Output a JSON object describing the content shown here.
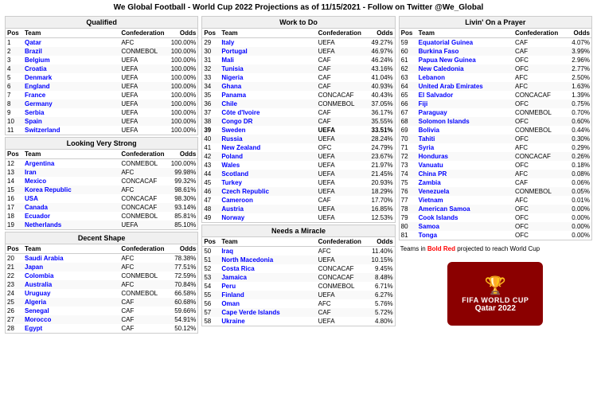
{
  "header": {
    "title": "We Global Football - World Cup 2022 Projections as of 11/15/2021 - Follow on Twitter @We_Global"
  },
  "sections": {
    "qualified": {
      "title": "Qualified",
      "columns": [
        "Pos",
        "Team",
        "Confederation",
        "Odds"
      ],
      "rows": [
        {
          "pos": "1",
          "team": "Qatar",
          "conf": "AFC",
          "odds": "100.00%"
        },
        {
          "pos": "2",
          "team": "Brazil",
          "conf": "CONMEBOL",
          "odds": "100.00%"
        },
        {
          "pos": "3",
          "team": "Belgium",
          "conf": "UEFA",
          "odds": "100.00%"
        },
        {
          "pos": "4",
          "team": "Croatia",
          "conf": "UEFA",
          "odds": "100.00%"
        },
        {
          "pos": "5",
          "team": "Denmark",
          "conf": "UEFA",
          "odds": "100.00%"
        },
        {
          "pos": "6",
          "team": "England",
          "conf": "UEFA",
          "odds": "100.00%"
        },
        {
          "pos": "7",
          "team": "France",
          "conf": "UEFA",
          "odds": "100.00%"
        },
        {
          "pos": "8",
          "team": "Germany",
          "conf": "UEFA",
          "odds": "100.00%"
        },
        {
          "pos": "9",
          "team": "Serbia",
          "conf": "UEFA",
          "odds": "100.00%"
        },
        {
          "pos": "10",
          "team": "Spain",
          "conf": "UEFA",
          "odds": "100.00%"
        },
        {
          "pos": "11",
          "team": "Switzerland",
          "conf": "UEFA",
          "odds": "100.00%"
        }
      ]
    },
    "looking_strong": {
      "title": "Looking Very Strong",
      "columns": [
        "Pos",
        "Team",
        "Confederation",
        "Odds"
      ],
      "rows": [
        {
          "pos": "12",
          "team": "Argentina",
          "conf": "CONMEBOL",
          "odds": "100.00%"
        },
        {
          "pos": "13",
          "team": "Iran",
          "conf": "AFC",
          "odds": "99.98%"
        },
        {
          "pos": "14",
          "team": "Mexico",
          "conf": "CONCACAF",
          "odds": "99.32%"
        },
        {
          "pos": "15",
          "team": "Korea Republic",
          "conf": "AFC",
          "odds": "98.61%"
        },
        {
          "pos": "16",
          "team": "USA",
          "conf": "CONCACAF",
          "odds": "98.30%"
        },
        {
          "pos": "17",
          "team": "Canada",
          "conf": "CONCACAF",
          "odds": "93.14%"
        },
        {
          "pos": "18",
          "team": "Ecuador",
          "conf": "CONMEBOL",
          "odds": "85.81%"
        },
        {
          "pos": "19",
          "team": "Netherlands",
          "conf": "UEFA",
          "odds": "85.10%"
        }
      ]
    },
    "decent": {
      "title": "Decent Shape",
      "columns": [
        "Pos",
        "Team",
        "Confederation",
        "Odds"
      ],
      "rows": [
        {
          "pos": "20",
          "team": "Saudi Arabia",
          "conf": "AFC",
          "odds": "78.38%"
        },
        {
          "pos": "21",
          "team": "Japan",
          "conf": "AFC",
          "odds": "77.51%"
        },
        {
          "pos": "22",
          "team": "Colombia",
          "conf": "CONMEBOL",
          "odds": "72.59%"
        },
        {
          "pos": "23",
          "team": "Australia",
          "conf": "AFC",
          "odds": "70.84%"
        },
        {
          "pos": "24",
          "team": "Uruguay",
          "conf": "CONMEBOL",
          "odds": "66.58%"
        },
        {
          "pos": "25",
          "team": "Algeria",
          "conf": "CAF",
          "odds": "60.68%"
        },
        {
          "pos": "26",
          "team": "Senegal",
          "conf": "CAF",
          "odds": "59.66%"
        },
        {
          "pos": "27",
          "team": "Morocco",
          "conf": "CAF",
          "odds": "54.91%"
        },
        {
          "pos": "28",
          "team": "Egypt",
          "conf": "CAF",
          "odds": "50.12%"
        }
      ]
    },
    "work_todo": {
      "title": "Work to Do",
      "columns": [
        "Pos",
        "Team",
        "Confederation",
        "Odds"
      ],
      "rows": [
        {
          "pos": "29",
          "team": "Italy",
          "conf": "UEFA",
          "odds": "49.27%"
        },
        {
          "pos": "30",
          "team": "Portugal",
          "conf": "UEFA",
          "odds": "46.97%"
        },
        {
          "pos": "31",
          "team": "Mali",
          "conf": "CAF",
          "odds": "46.24%"
        },
        {
          "pos": "32",
          "team": "Tunisia",
          "conf": "CAF",
          "odds": "43.16%"
        },
        {
          "pos": "33",
          "team": "Nigeria",
          "conf": "CAF",
          "odds": "41.04%"
        },
        {
          "pos": "34",
          "team": "Ghana",
          "conf": "CAF",
          "odds": "40.93%"
        },
        {
          "pos": "35",
          "team": "Panama",
          "conf": "CONCACAF",
          "odds": "40.43%"
        },
        {
          "pos": "36",
          "team": "Chile",
          "conf": "CONMEBOL",
          "odds": "37.05%"
        },
        {
          "pos": "37",
          "team": "Côte d'Ivoire",
          "conf": "CAF",
          "odds": "36.17%"
        },
        {
          "pos": "38",
          "team": "Congo DR",
          "conf": "CAF",
          "odds": "35.55%"
        },
        {
          "pos": "39",
          "team": "Sweden",
          "conf": "UEFA",
          "odds": "33.51%"
        },
        {
          "pos": "40",
          "team": "Russia",
          "conf": "UEFA",
          "odds": "28.24%"
        },
        {
          "pos": "41",
          "team": "New Zealand",
          "conf": "OFC",
          "odds": "24.79%"
        },
        {
          "pos": "42",
          "team": "Poland",
          "conf": "UEFA",
          "odds": "23.67%"
        },
        {
          "pos": "43",
          "team": "Wales",
          "conf": "UEFA",
          "odds": "21.97%"
        },
        {
          "pos": "44",
          "team": "Scotland",
          "conf": "UEFA",
          "odds": "21.45%"
        },
        {
          "pos": "45",
          "team": "Turkey",
          "conf": "UEFA",
          "odds": "20.93%"
        },
        {
          "pos": "46",
          "team": "Czech Republic",
          "conf": "UEFA",
          "odds": "18.29%"
        },
        {
          "pos": "47",
          "team": "Cameroon",
          "conf": "CAF",
          "odds": "17.70%"
        },
        {
          "pos": "48",
          "team": "Austria",
          "conf": "UEFA",
          "odds": "16.85%"
        },
        {
          "pos": "49",
          "team": "Norway",
          "conf": "UEFA",
          "odds": "12.53%"
        }
      ]
    },
    "miracle": {
      "title": "Needs a Miracle",
      "columns": [
        "Pos",
        "Team",
        "Confederation",
        "Odds"
      ],
      "rows": [
        {
          "pos": "50",
          "team": "Iraq",
          "conf": "AFC",
          "odds": "11.40%"
        },
        {
          "pos": "51",
          "team": "North Macedonia",
          "conf": "UEFA",
          "odds": "10.15%"
        },
        {
          "pos": "52",
          "team": "Costa Rica",
          "conf": "CONCACAF",
          "odds": "9.45%"
        },
        {
          "pos": "53",
          "team": "Jamaica",
          "conf": "CONCACAF",
          "odds": "8.48%"
        },
        {
          "pos": "54",
          "team": "Peru",
          "conf": "CONMEBOL",
          "odds": "6.71%"
        },
        {
          "pos": "55",
          "team": "Finland",
          "conf": "UEFA",
          "odds": "6.27%"
        },
        {
          "pos": "56",
          "team": "Oman",
          "conf": "AFC",
          "odds": "5.76%"
        },
        {
          "pos": "57",
          "team": "Cape Verde Islands",
          "conf": "CAF",
          "odds": "5.72%"
        },
        {
          "pos": "58",
          "team": "Ukraine",
          "conf": "UEFA",
          "odds": "4.80%"
        }
      ]
    },
    "prayer": {
      "title": "Livin' On a Prayer",
      "columns": [
        "Pos",
        "Team",
        "Confederation",
        "Odds"
      ],
      "rows": [
        {
          "pos": "59",
          "team": "Equatorial Guinea",
          "conf": "CAF",
          "odds": "4.07%"
        },
        {
          "pos": "60",
          "team": "Burkina Faso",
          "conf": "CAF",
          "odds": "3.99%"
        },
        {
          "pos": "61",
          "team": "Papua New Guinea",
          "conf": "OFC",
          "odds": "2.96%"
        },
        {
          "pos": "62",
          "team": "New Caledonia",
          "conf": "OFC",
          "odds": "2.77%"
        },
        {
          "pos": "63",
          "team": "Lebanon",
          "conf": "AFC",
          "odds": "2.50%"
        },
        {
          "pos": "64",
          "team": "United Arab Emirates",
          "conf": "AFC",
          "odds": "1.63%"
        },
        {
          "pos": "65",
          "team": "El Salvador",
          "conf": "CONCACAF",
          "odds": "1.39%"
        },
        {
          "pos": "66",
          "team": "Fiji",
          "conf": "OFC",
          "odds": "0.75%"
        },
        {
          "pos": "67",
          "team": "Paraguay",
          "conf": "CONMEBOL",
          "odds": "0.70%"
        },
        {
          "pos": "68",
          "team": "Solomon Islands",
          "conf": "OFC",
          "odds": "0.60%"
        },
        {
          "pos": "69",
          "team": "Bolivia",
          "conf": "CONMEBOL",
          "odds": "0.44%"
        },
        {
          "pos": "70",
          "team": "Tahiti",
          "conf": "OFC",
          "odds": "0.30%"
        },
        {
          "pos": "71",
          "team": "Syria",
          "conf": "AFC",
          "odds": "0.29%"
        },
        {
          "pos": "72",
          "team": "Honduras",
          "conf": "CONCACAF",
          "odds": "0.26%"
        },
        {
          "pos": "73",
          "team": "Vanuatu",
          "conf": "OFC",
          "odds": "0.18%"
        },
        {
          "pos": "74",
          "team": "China PR",
          "conf": "AFC",
          "odds": "0.08%"
        },
        {
          "pos": "75",
          "team": "Zambia",
          "conf": "CAF",
          "odds": "0.06%"
        },
        {
          "pos": "76",
          "team": "Venezuela",
          "conf": "CONMEBOL",
          "odds": "0.05%"
        },
        {
          "pos": "77",
          "team": "Vietnam",
          "conf": "AFC",
          "odds": "0.01%"
        },
        {
          "pos": "78",
          "team": "American Samoa",
          "conf": "OFC",
          "odds": "0.00%"
        },
        {
          "pos": "79",
          "team": "Cook Islands",
          "conf": "OFC",
          "odds": "0.00%"
        },
        {
          "pos": "80",
          "team": "Samoa",
          "conf": "OFC",
          "odds": "0.00%"
        },
        {
          "pos": "81",
          "team": "Tonga",
          "conf": "OFC",
          "odds": "0.00%"
        }
      ]
    }
  },
  "legend": "Teams in Bold Red projected to reach World Cup",
  "fifa_logo": {
    "line1": "FIFA WORLD CUP",
    "line2": "Qatar 2022"
  }
}
